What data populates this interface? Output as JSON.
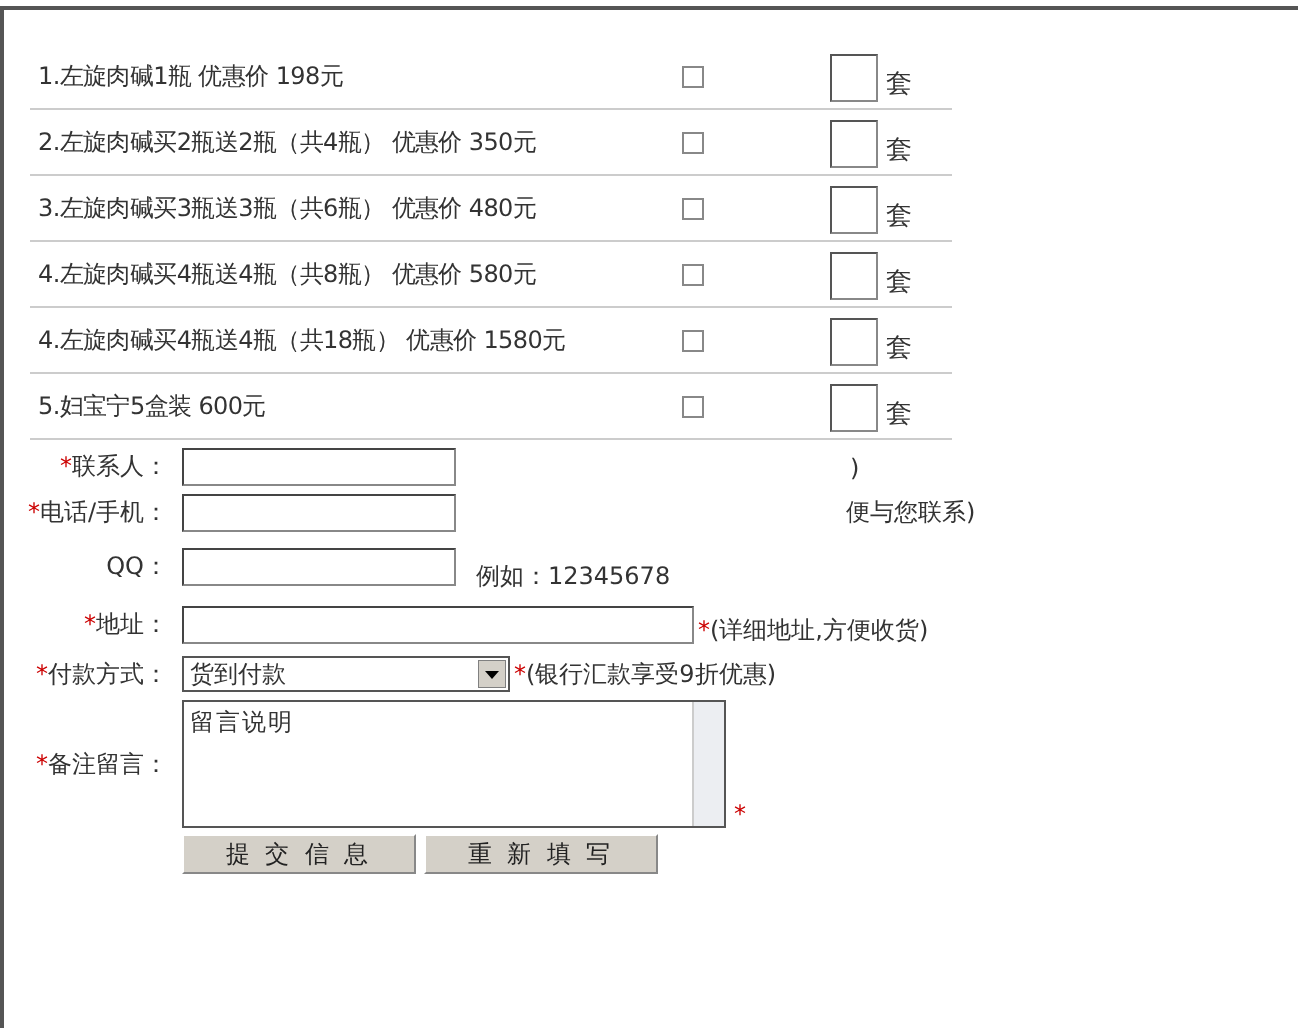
{
  "products": [
    {
      "label": "1.左旋肉碱1瓶  优惠价  198元",
      "checked": false,
      "unit": "套"
    },
    {
      "label": "2.左旋肉碱买2瓶送2瓶（共4瓶）  优惠价  350元",
      "checked": false,
      "unit": "套"
    },
    {
      "label": "3.左旋肉碱买3瓶送3瓶（共6瓶）  优惠价  480元",
      "checked": false,
      "unit": "套"
    },
    {
      "label": "4.左旋肉碱买4瓶送4瓶（共8瓶）  优惠价  580元",
      "checked": false,
      "unit": "套"
    },
    {
      "label": "4.左旋肉碱买4瓶送4瓶（共18瓶）  优惠价  1580元",
      "checked": false,
      "unit": "套"
    },
    {
      "label": "5.妇宝宁5盒装  600元",
      "checked": false,
      "unit": "套"
    }
  ],
  "form": [
    {
      "kind": "short_text",
      "marker": "*",
      "label": "联系人：",
      "hint": ")"
    },
    {
      "kind": "short_text",
      "marker": "*",
      "label": "电话/手机：",
      "hint": "便与您联系)"
    },
    {
      "kind": "short_text",
      "label": "QQ：",
      "hint": "例如：12345678"
    },
    {
      "kind": "long_text",
      "marker": "*",
      "label": "地址：",
      "hint_marker": "*",
      "hint": "(详细地址,方便收货)"
    },
    {
      "kind": "select",
      "marker": "*",
      "label": "付款方式：",
      "value": "货到付款",
      "hint_marker": "*",
      "hint": "(银行汇款享受9折优惠)"
    },
    {
      "kind": "textarea",
      "marker": "*",
      "label": "备注留言：",
      "value": "留言说明",
      "hint_marker": "*"
    }
  ],
  "buttons": [
    "提 交 信 息",
    "重 新 填 写"
  ]
}
